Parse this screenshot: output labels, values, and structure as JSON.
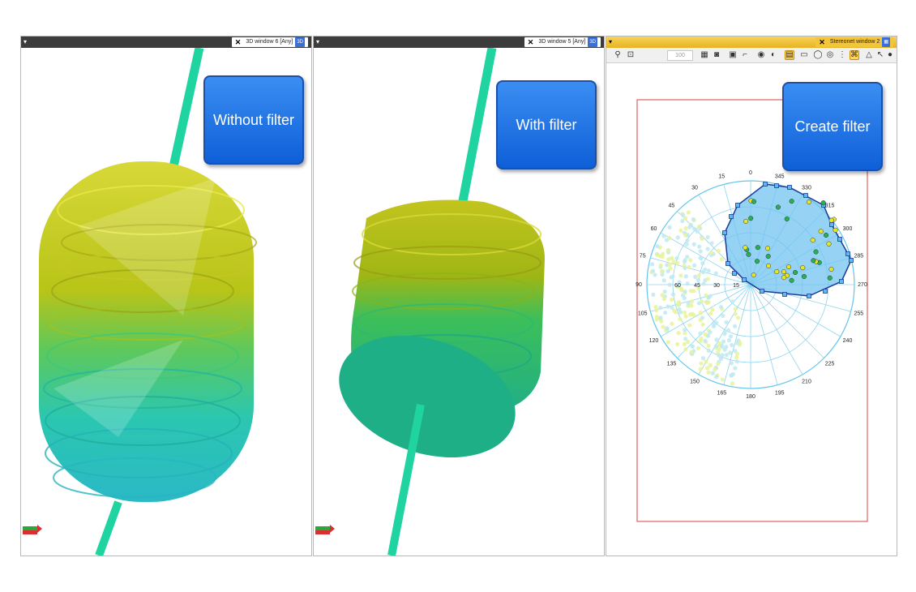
{
  "left_pane": {
    "title": "3D window 6 [Any]",
    "badge": "3D",
    "menu": "▾",
    "close": "✕",
    "label": "Without filter"
  },
  "middle_pane": {
    "title": "3D window 5 [Any]",
    "badge": "3D",
    "menu": "▾",
    "close": "✕",
    "label": "With filter"
  },
  "right_pane": {
    "title": "Stereonet window 2",
    "badge": "▦",
    "menu": "▾",
    "close": "✕",
    "label": "Create filter",
    "toolbar_input": "100",
    "stereonet_labels": [
      "0",
      "15",
      "30",
      "45",
      "60",
      "75",
      "90",
      "105",
      "120",
      "135",
      "150",
      "165",
      "180",
      "195",
      "210",
      "225",
      "240",
      "255",
      "270",
      "285",
      "300",
      "315",
      "330",
      "345"
    ],
    "center_labels": [
      "15",
      "30",
      "45",
      "60"
    ]
  },
  "colors": {
    "well": "#1fd4a0",
    "label_blue": "#1b6fe6",
    "filter_fill": "#71c3f0",
    "filter_border": "#1a3b9a",
    "stereonet_line": "#62c6ea",
    "frame_red": "#e06060"
  }
}
